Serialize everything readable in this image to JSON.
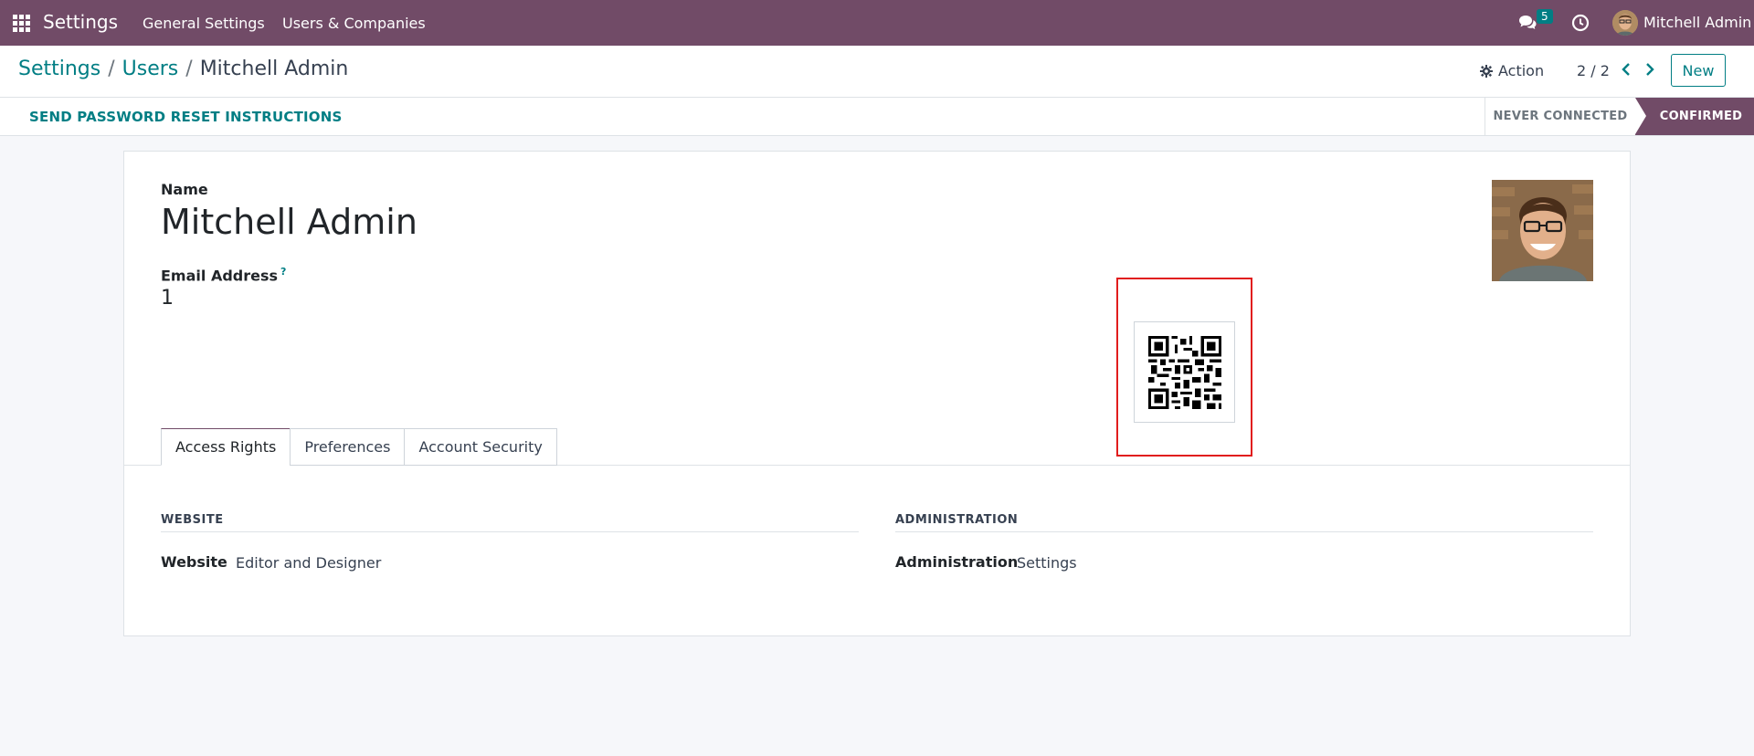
{
  "navbar": {
    "brand": "Settings",
    "menu": [
      "General Settings",
      "Users & Companies"
    ],
    "messages_badge": "5",
    "user_name": "Mitchell Admin",
    "bg_color": "#714b67"
  },
  "breadcrumb": {
    "items": [
      "Settings",
      "Users"
    ],
    "current": "Mitchell Admin",
    "separator": "/"
  },
  "controls": {
    "action_label": "Action",
    "pager": "2 / 2",
    "new_label": "New"
  },
  "statusbar": {
    "reset_label": "SEND PASSWORD RESET INSTRUCTIONS",
    "stages": [
      "NEVER CONNECTED",
      "CONFIRMED"
    ],
    "active_stage": "CONFIRMED"
  },
  "form": {
    "name_label": "Name",
    "name_value": "Mitchell Admin",
    "email_label": "Email Address",
    "email_help": "?",
    "email_value": "1"
  },
  "tabs": [
    "Access Rights",
    "Preferences",
    "Account Security"
  ],
  "active_tab": "Access Rights",
  "access_rights": {
    "website": {
      "title": "WEBSITE",
      "field_label": "Website",
      "field_value": "Editor and Designer"
    },
    "administration": {
      "title": "ADMINISTRATION",
      "field_label": "Administration",
      "field_value": "Settings"
    }
  },
  "colors": {
    "primary": "#714b67",
    "accent": "#017e84",
    "highlight": "#e11d1d"
  }
}
